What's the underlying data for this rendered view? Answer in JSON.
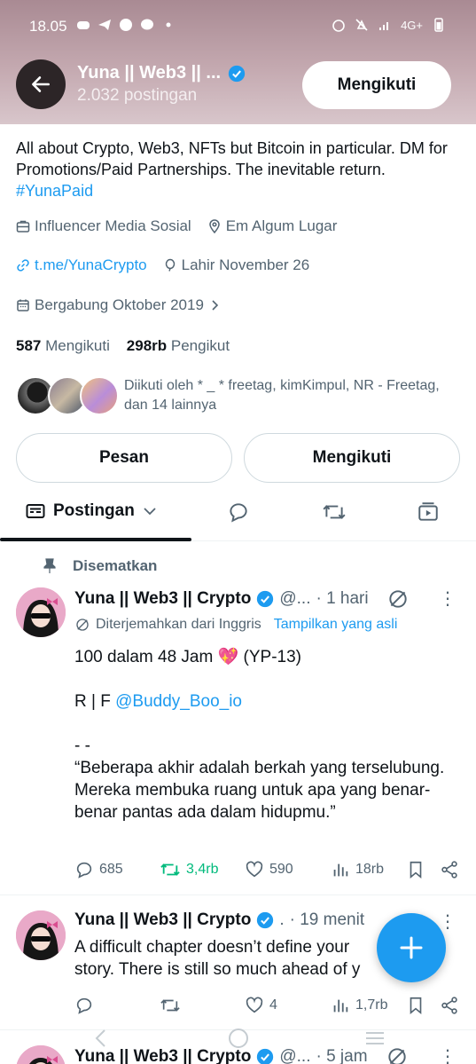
{
  "status_bar": {
    "time": "18.05",
    "network": "4G+"
  },
  "header": {
    "name": "Yuna || Web3 || ...",
    "post_count": "2.032 postingan",
    "follow_button": "Mengikuti"
  },
  "bio": {
    "text": "All about Crypto, Web3, NFTs but Bitcoin in particular. DM for Promotions/Paid Partnerships. The inevitable return. ",
    "hashtag": "#YunaPaid"
  },
  "meta": {
    "category": "Influencer Media Sosial",
    "location": "Em Algum Lugar",
    "link": "t.me/YunaCrypto",
    "birthday": "Lahir November 26",
    "joined": "Bergabung Oktober 2019"
  },
  "stats": {
    "following_count": "587",
    "following_label": "Mengikuti",
    "followers_count": "298rb",
    "followers_label": "Pengikut"
  },
  "followed_by": "Diikuti oleh * _ * freetag, kimKimpul, NR - Freetag, dan 14 lainnya",
  "buttons": {
    "message": "Pesan",
    "following": "Mengikuti"
  },
  "tabs": {
    "posts": "Postingan"
  },
  "pinned_label": "Disematkan",
  "posts": [
    {
      "name": "Yuna || Web3 || Crypto",
      "handle": "@...",
      "time": "· 1 hari",
      "translated_label": "Diterjemahkan dari Inggris",
      "show_original": "Tampilkan yang asli",
      "line1": "100 dalam 48 Jam 💖 (YP-13)",
      "line2_prefix": "R | F ",
      "line2_mention": "@Buddy_Boo_io",
      "line3": "- -",
      "line4": "“Beberapa akhir adalah berkah yang terselubung. Mereka membuka ruang untuk apa yang benar-benar pantas ada dalam hidupmu.”",
      "replies": "685",
      "reposts": "3,4rb",
      "likes": "590",
      "views": "18rb"
    },
    {
      "name": "Yuna || Web3 || Crypto",
      "handle": ".",
      "time": "· 19 menit",
      "text": "A difficult chapter doesn’t define your story. There is still so much ahead of y",
      "replies": "",
      "reposts": "",
      "likes": "4",
      "views": "1,7rb"
    },
    {
      "name": "Yuna || Web3 || Crypto",
      "handle": "@...",
      "time": "· 5 jam"
    }
  ],
  "colors": {
    "accent": "#1d9bf0",
    "repost_active": "#00ba7c",
    "text_secondary": "#536471"
  }
}
